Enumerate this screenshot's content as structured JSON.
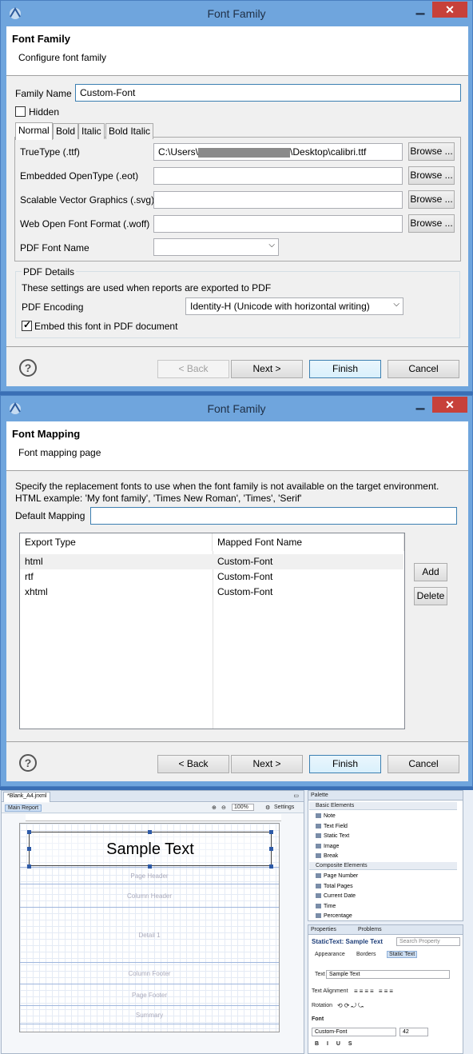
{
  "window1": {
    "title": "Font Family",
    "banner_title": "Font Family",
    "banner_sub": "Configure font family",
    "family_label": "Family Name",
    "family_value": "Custom-Font",
    "hidden_label": "Hidden",
    "tabs": [
      "Normal",
      "Bold",
      "Italic",
      "Bold Italic"
    ],
    "rows": [
      {
        "label": "TrueType (.ttf)",
        "value_pre": "C:\\Users\\",
        "value_post": "\\Desktop\\calibri.ttf"
      },
      {
        "label": "Embedded OpenType (.eot)",
        "value": ""
      },
      {
        "label": "Scalable Vector Graphics (.svg)",
        "value": ""
      },
      {
        "label": "Web Open Font Format (.woff)",
        "value": ""
      }
    ],
    "browse_label": "Browse ...",
    "pdf_font_label": "PDF Font Name",
    "pdf_details_title": "PDF Details",
    "pdf_details_desc": "These settings are used when reports are exported to PDF",
    "pdf_encoding_label": "PDF Encoding",
    "pdf_encoding_value": "Identity-H (Unicode with horizontal writing)",
    "embed_label": "Embed this font in PDF document",
    "buttons": {
      "back": "< Back",
      "next": "Next >",
      "finish": "Finish",
      "cancel": "Cancel"
    }
  },
  "window2": {
    "title": "Font Family",
    "banner_title": "Font Mapping",
    "banner_sub": "Font mapping page",
    "desc1": "Specify the replacement fonts to use when the font family is not available on the target environment.",
    "desc2": "HTML example: 'My font family', 'Times New Roman', 'Times', 'Serif'",
    "default_label": "Default Mapping",
    "default_value": "",
    "columns": [
      "Export Type",
      "Mapped Font Name"
    ],
    "rows": [
      {
        "type": "html",
        "font": "Custom-Font"
      },
      {
        "type": "rtf",
        "font": "Custom-Font"
      },
      {
        "type": "xhtml",
        "font": "Custom-Font"
      }
    ],
    "add_label": "Add",
    "delete_label": "Delete",
    "buttons": {
      "back": "< Back",
      "next": "Next >",
      "finish": "Finish",
      "cancel": "Cancel"
    }
  },
  "ide": {
    "editor_tab": "*Blank_A4.jrxml",
    "main_report": "Main Report",
    "zoom": "100%",
    "settings": "Settings",
    "sample_text": "Sample Text",
    "bands": [
      "Page Header",
      "Column Header",
      "Detail 1",
      "Column Footer",
      "Page Footer",
      "Summary"
    ],
    "palette_title": "Palette",
    "basic_elements": "Basic Elements",
    "basic_items": [
      "Note",
      "Text Field",
      "Static Text",
      "Image",
      "Break"
    ],
    "composite_elements": "Composite Elements",
    "composite_items": [
      "Page Number",
      "Total Pages",
      "Current Date",
      "Time",
      "Percentage"
    ],
    "properties_tab": "Properties",
    "problems_tab": "Problems",
    "prop_title": "StaticText: Sample Text",
    "search_property": "Search Property",
    "prop_tabs": [
      "Appearance",
      "Borders",
      "Static Text"
    ],
    "text_label": "Text",
    "text_value": "Sample Text",
    "text_alignment_label": "Text Alignment",
    "rotation_label": "Rotation",
    "font_section": "Font",
    "font_name": "Custom-Font",
    "font_size": "42"
  }
}
